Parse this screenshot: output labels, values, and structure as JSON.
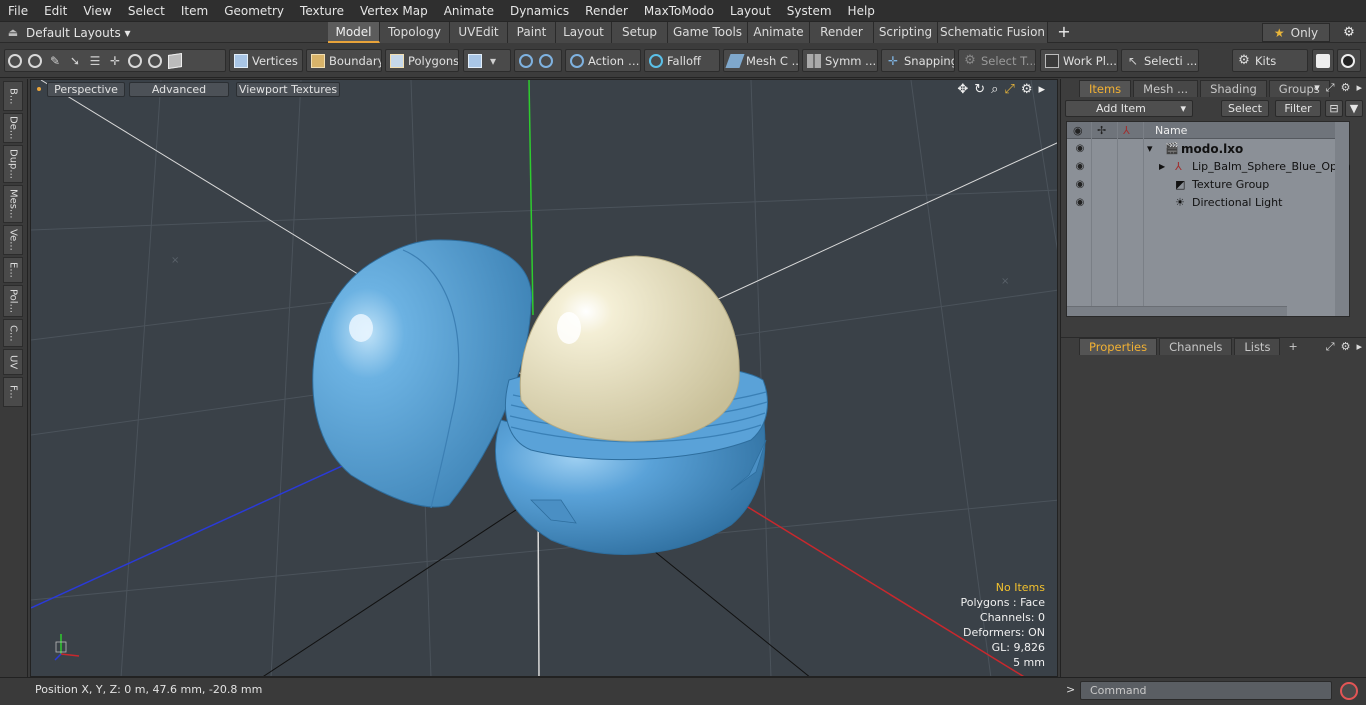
{
  "menubar": {
    "items": [
      "File",
      "Edit",
      "View",
      "Select",
      "Item",
      "Geometry",
      "Texture",
      "Vertex Map",
      "Animate",
      "Dynamics",
      "Render",
      "MaxToModo",
      "Layout",
      "System",
      "Help"
    ]
  },
  "layoutbar": {
    "layouts_label": "Default Layouts ▾",
    "tabs": [
      {
        "label": "Model",
        "active": true
      },
      {
        "label": "Topology"
      },
      {
        "label": "UVEdit"
      },
      {
        "label": "Paint"
      },
      {
        "label": "Layout"
      },
      {
        "label": "Setup"
      },
      {
        "label": "Game Tools"
      },
      {
        "label": "Animate"
      },
      {
        "label": "Render"
      },
      {
        "label": "Scripting"
      },
      {
        "label": "Schematic Fusion"
      }
    ],
    "add_tab": "+",
    "only_label": "Only"
  },
  "toolbar": {
    "vertices": "Vertices",
    "boundary": "Boundary",
    "polygons": "Polygons",
    "action": "Action",
    "falloff": "Falloff",
    "mesh_c": "Mesh C ...",
    "symm": "Symm ...",
    "snapping": "Snapping",
    "select_t": "Select T...",
    "work_pl": "Work Pl...",
    "selecti": "Selecti ...",
    "kits": "Kits"
  },
  "left_strip": {
    "tabs": [
      "B...",
      "De...",
      "Dup...",
      "Mes...",
      "Ve...",
      "E...",
      "Pol...",
      "C...",
      "UV",
      "F..."
    ]
  },
  "viewport": {
    "view_label": "Perspective",
    "advanced_label": "Advanced",
    "textures_label": "Viewport Textures",
    "stats": {
      "selection": "No Items",
      "polygons": "Polygons : Face",
      "channels": "Channels: 0",
      "deformers": "Deformers: ON",
      "gl": "GL: 9,826",
      "scale": "5 mm"
    },
    "colors": {
      "background": "#3a4148",
      "shell": "#5aa2d8",
      "balm": "#eee8c8",
      "axis_x": "#c8282d",
      "axis_y": "#2ecc2e",
      "axis_z": "#2a3ad8"
    }
  },
  "statusbar": {
    "position": "Position X, Y, Z:   0 m, 47.6 mm, -20.8 mm"
  },
  "items_panel": {
    "tabs": [
      {
        "label": "Items",
        "active": true
      },
      {
        "label": "Mesh ..."
      },
      {
        "label": "Shading"
      },
      {
        "label": "Groups"
      }
    ],
    "add_item": "Add Item",
    "select": "Select",
    "filter": "Filter",
    "name_header": "Name",
    "rows": [
      {
        "label": "modo.lxo",
        "bold": true,
        "indent": 0
      },
      {
        "label": "Lip_Balm_Sphere_Blue_Open",
        "indent": 1
      },
      {
        "label": "Texture Group",
        "indent": 1
      },
      {
        "label": "Directional Light",
        "indent": 1
      }
    ]
  },
  "properties_panel": {
    "tabs": [
      {
        "label": "Properties",
        "active": true
      },
      {
        "label": "Channels"
      },
      {
        "label": "Lists"
      }
    ],
    "add_tab": "+"
  },
  "command": {
    "prompt": ">",
    "placeholder": "Command"
  }
}
